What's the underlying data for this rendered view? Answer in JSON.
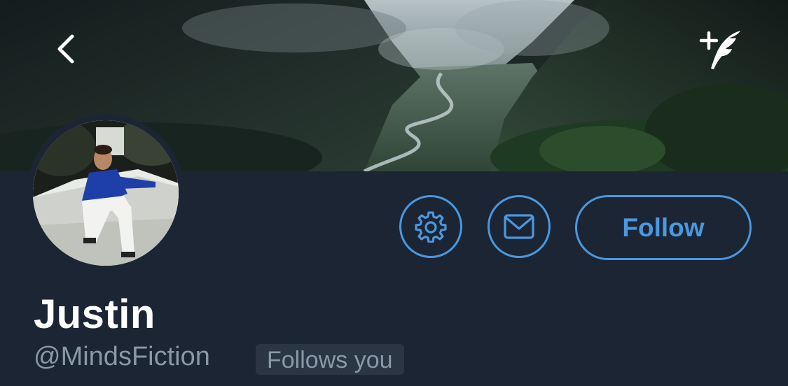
{
  "header": {
    "back_icon": "chevron-left-icon",
    "compose_icon": "compose-tweet-icon"
  },
  "profile": {
    "display_name": "Justin",
    "handle": "@MindsFiction",
    "follows_you_label": "Follows you"
  },
  "actions": {
    "settings_icon": "gear-icon",
    "message_icon": "envelope-icon",
    "follow_label": "Follow"
  },
  "colors": {
    "background": "#1c2533",
    "accent": "#4a98e0",
    "secondary_text": "#8899a6"
  }
}
